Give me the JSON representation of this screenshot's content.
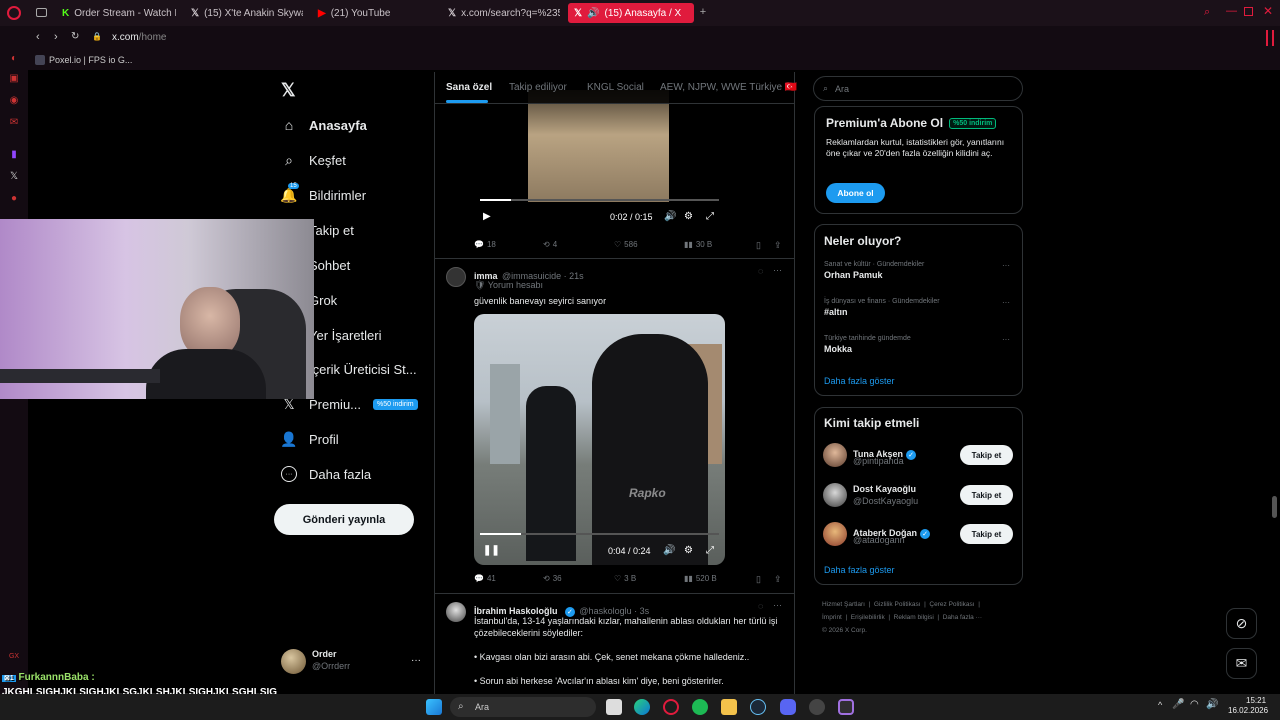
{
  "browser": {
    "tabs": [
      {
        "title": "Order Stream - Watch Live",
        "icon": "kick-icon"
      },
      {
        "title": "(15) X'te Anakin Skywalker",
        "icon": "x-icon"
      },
      {
        "title": "(21) YouTube",
        "icon": "youtube-icon"
      },
      {
        "title": "x.com/search?q=%23500",
        "icon": "x-icon"
      },
      {
        "title": "(15) Anasayfa / X",
        "icon": "x-icon"
      }
    ],
    "url_prefix": "x.com",
    "url_path": "/home",
    "bookmark": "Poxel.io | FPS io G..."
  },
  "nav": {
    "items": [
      {
        "label": "Anasayfa",
        "icon": "home-icon"
      },
      {
        "label": "Keşfet",
        "icon": "search-icon"
      },
      {
        "label": "Bildirimler",
        "icon": "bell-icon",
        "badge": "15"
      },
      {
        "label": "Takip et",
        "icon": "person-plus-icon"
      },
      {
        "label": "Sohbet",
        "icon": "chat-icon"
      },
      {
        "label": "Grok",
        "icon": "grok-icon"
      },
      {
        "label": "Yer İşaretleri",
        "icon": "bookmark-icon"
      },
      {
        "label": "İçerik Üreticisi St...",
        "icon": "creator-icon"
      },
      {
        "label": "Premiu...",
        "icon": "x-icon",
        "badge": "%50 indirim"
      },
      {
        "label": "Profil",
        "icon": "profile-icon"
      },
      {
        "label": "Daha fazla",
        "icon": "more-icon"
      }
    ],
    "post_button": "Gönderi yayınla",
    "account": {
      "name": "Order",
      "handle": "@Orrderr"
    }
  },
  "feed": {
    "tabs": [
      "Sana özel",
      "Takip ediliyor",
      "KNGL Social",
      "AEW, NJPW, WWE Türkiye 🇹🇷"
    ],
    "tweet1": {
      "video_time": "0:02 / 0:15",
      "video_progress": 0.13,
      "stats": {
        "replies": "18",
        "reposts": "4",
        "likes": "586",
        "views": "30 B"
      }
    },
    "tweet2": {
      "name": "imma",
      "handle": "@immasuicide · 21s",
      "comment_label": "Yorum hesabı",
      "text": "güvenlik banevayı seyirci sanıyor",
      "video_time": "0:04 / 0:24",
      "video_progress": 0.17,
      "watermark": "Rapko",
      "stats": {
        "replies": "41",
        "reposts": "36",
        "likes": "3 B",
        "views": "520 B"
      }
    },
    "tweet3": {
      "name": "İbrahim Haskoloğlu",
      "handle": "@haskologlu · 3s",
      "text1": "İstanbul'da, 13-14 yaşlarındaki kızlar, mahallenin ablası oldukları her türlü işi çözebileceklerini söylediler:",
      "text2": "• Kavgası olan bizi arasın abi. Çek, senet mekana çökme halledeniz..",
      "text3": "• Sorun abi herkese 'Avcılar'ın ablası kim' diye, beni gösterirler."
    }
  },
  "sidebar": {
    "search_placeholder": "Ara",
    "premium": {
      "title": "Premium'a Abone Ol",
      "badge": "%50 indirim",
      "text": "Reklamlardan kurtul, istatistikleri gör, yanıtlarını öne çıkar ve 20'den fazla özelliğin kilidini aç.",
      "button": "Abone ol"
    },
    "trends": {
      "title": "Neler oluyor?",
      "items": [
        {
          "meta": "Sanat ve kültür · Gündemdekiler",
          "name": "Orhan Pamuk"
        },
        {
          "meta": "İş dünyası ve finans · Gündemdekiler",
          "name": "#altın"
        },
        {
          "meta": "Türkiye tarihinde gündemde",
          "name": "Mokka"
        }
      ],
      "more": "Daha fazla göster"
    },
    "who_to_follow": {
      "title": "Kimi takip etmeli",
      "items": [
        {
          "name": "Tuna Akşen",
          "handle": "@pintipanda",
          "button": "Takip et"
        },
        {
          "name": "Dost Kayaoğlu",
          "handle": "@DostKayaoglu",
          "button": "Takip et"
        },
        {
          "name": "Ataberk Doğan",
          "handle": "@atadogann",
          "button": "Takip et"
        }
      ],
      "more": "Daha fazla göster"
    },
    "footer": [
      "Hizmet Şartları",
      "Gizlilik Politikası",
      "Çerez Politikası",
      "İmprint",
      "Erişilebilirlik",
      "Reklam bilgisi",
      "Daha fazla ···",
      "© 2026 X Corp."
    ]
  },
  "chat_overlay": {
    "user": "FurkannnBaba :",
    "message": "JKGHLŞIGHJKLŞIGHJKLŞGJKLŞHJKLŞIGHJKLŞGHLŞIG JKLŞIHJKLŞHJKLŞI"
  },
  "taskbar": {
    "search": "Ara",
    "time": "15:21",
    "date": "16.02.2026"
  },
  "colors": {
    "accent": "#1d9bf0",
    "opera_red": "#e01b3d",
    "premium_green": "#00ba7c"
  }
}
